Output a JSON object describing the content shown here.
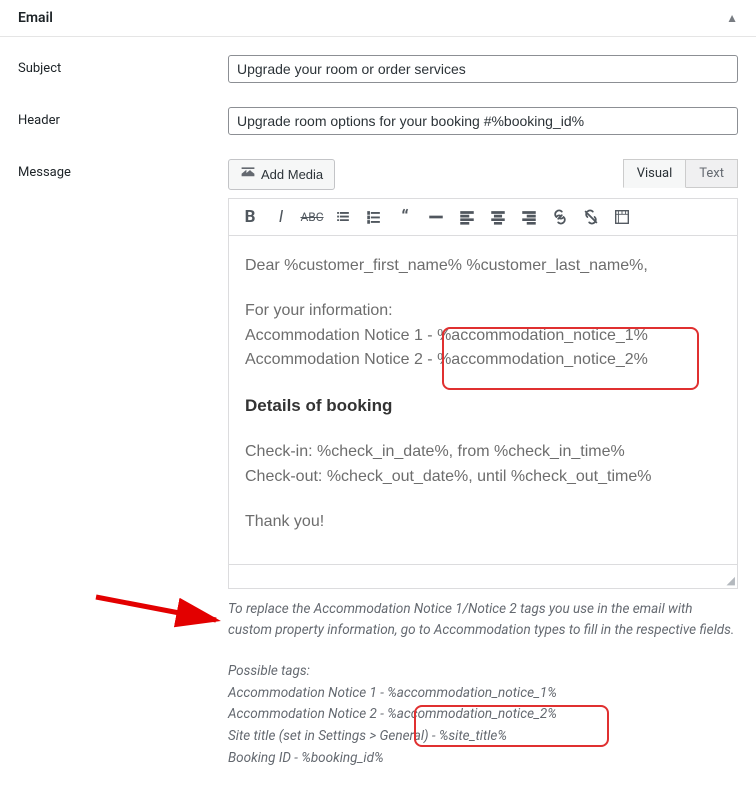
{
  "section": {
    "title": "Email"
  },
  "fields": {
    "subject_label": "Subject",
    "subject_value": "Upgrade your room or order services",
    "header_label": "Header",
    "header_value": "Upgrade room options for your booking #%booking_id%",
    "message_label": "Message"
  },
  "media_button": "Add Media",
  "tabs": {
    "visual": "Visual",
    "text": "Text"
  },
  "toolbar_icons": {
    "bold": "B",
    "italic": "I"
  },
  "editor": {
    "line1": "Dear %customer_first_name% %customer_last_name%,",
    "line2": "For your information:",
    "line3": "Accommodation Notice 1 - %accommodation_notice_1%",
    "line4": "Accommodation Notice 2 - %accommodation_notice_2%",
    "heading": "Details of booking",
    "line5": "Check-in: %check_in_date%, from %check_in_time%",
    "line6": "Check-out: %check_out_date%, until %check_out_time%",
    "line7": "Thank you!"
  },
  "help": {
    "para": "To replace the Accommodation Notice 1/Notice 2 tags you use in the email with custom property information, go to Accommodation types to fill in the respective fields.",
    "tags_heading": "Possible tags:",
    "t1": "Accommodation Notice 1 - %accommodation_notice_1%",
    "t2": "Accommodation Notice 2 - %accommodation_notice_2%",
    "t3": "Site title (set in Settings > General) - %site_title%",
    "t4": "Booking ID - %booking_id%"
  }
}
